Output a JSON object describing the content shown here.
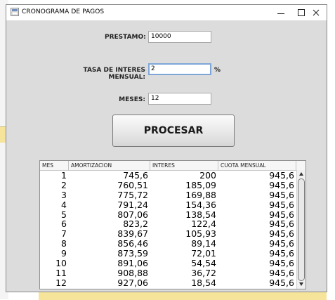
{
  "window": {
    "title": "CRONOGRAMA DE PAGOS"
  },
  "form": {
    "prestamo_label": "PRESTAMO:",
    "prestamo_value": "10000",
    "tasa_label": "TASA DE INTERES MENSUAL:",
    "tasa_value": "2",
    "tasa_unit": "%",
    "meses_label": "MESES:",
    "meses_value": "12"
  },
  "button": {
    "procesar_label": "PROCESAR"
  },
  "table": {
    "headers": [
      "MES",
      "AMORTIZACION",
      "INTERES",
      "CUOTA MENSUAL"
    ],
    "rows": [
      [
        "1",
        "745,6",
        "200",
        "945,6"
      ],
      [
        "2",
        "760,51",
        "185,09",
        "945,6"
      ],
      [
        "3",
        "775,72",
        "169,88",
        "945,6"
      ],
      [
        "4",
        "791,24",
        "154,36",
        "945,6"
      ],
      [
        "5",
        "807,06",
        "138,54",
        "945,6"
      ],
      [
        "6",
        "823,2",
        "122,4",
        "945,6"
      ],
      [
        "7",
        "839,67",
        "105,93",
        "945,6"
      ],
      [
        "8",
        "856,46",
        "89,14",
        "945,6"
      ],
      [
        "9",
        "873,59",
        "72,01",
        "945,6"
      ],
      [
        "10",
        "891,06",
        "54,54",
        "945,6"
      ],
      [
        "11",
        "908,88",
        "36,72",
        "945,6"
      ],
      [
        "12",
        "927,06",
        "18,54",
        "945,6"
      ]
    ]
  },
  "icons": {
    "app": "java-app-icon",
    "minimize": "minimize-icon",
    "maximize": "maximize-icon",
    "close": "close-icon"
  }
}
